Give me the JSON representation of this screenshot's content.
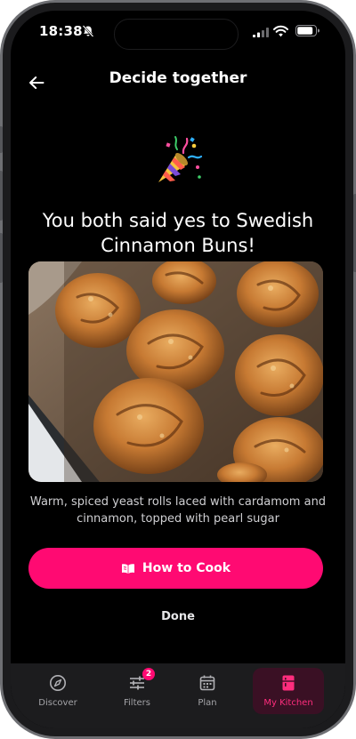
{
  "status_bar": {
    "time": "18:38"
  },
  "header": {
    "title": "Decide together"
  },
  "match": {
    "headline": "You both said yes to Swedish Cinnamon Buns!",
    "description": "Warm, spiced yeast rolls laced with cardamom and cinnamon, topped with pearl sugar"
  },
  "actions": {
    "how_to_cook_label": "How to Cook",
    "done_label": "Done"
  },
  "tab_bar": {
    "items": [
      {
        "label": "Discover",
        "icon": "compass-icon"
      },
      {
        "label": "Filters",
        "icon": "sliders-icon",
        "badge": "2"
      },
      {
        "label": "Plan",
        "icon": "calendar-icon"
      },
      {
        "label": "My Kitchen",
        "icon": "fridge-icon",
        "active": true
      }
    ]
  },
  "colors": {
    "accent": "#ff0a72",
    "background": "#000000",
    "tab_bar": "#1c1c1e"
  }
}
